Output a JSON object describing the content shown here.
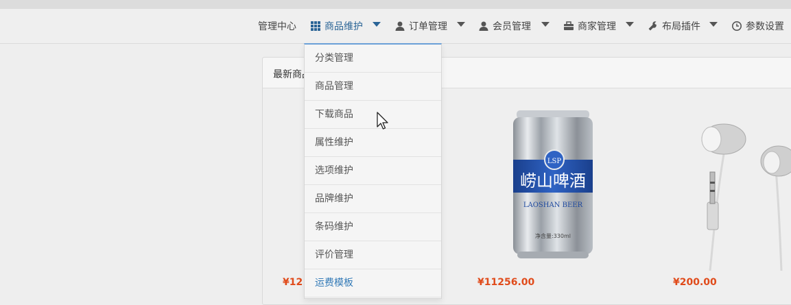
{
  "nav": {
    "items": [
      {
        "label": "管理中心"
      },
      {
        "label": "商品维护"
      },
      {
        "label": "订单管理"
      },
      {
        "label": "会员管理"
      },
      {
        "label": "商家管理"
      },
      {
        "label": "布局插件"
      },
      {
        "label": "参数设置"
      }
    ],
    "icons": [
      "grid-icon",
      "user-icon",
      "user-icon",
      "briefcase-icon",
      "wrench-icon",
      "clock-icon"
    ],
    "active_color": "#2a6496"
  },
  "dropdown": {
    "items": [
      {
        "label": "分类管理"
      },
      {
        "label": "商品管理"
      },
      {
        "label": "下载商品"
      },
      {
        "label": "属性维护"
      },
      {
        "label": "选项维护"
      },
      {
        "label": "品牌维护"
      },
      {
        "label": "条码维护"
      },
      {
        "label": "评价管理"
      },
      {
        "label": "运费模板"
      }
    ]
  },
  "panel": {
    "title": "最新商品"
  },
  "products": [
    {
      "price": "¥12",
      "image": "hidden-product"
    },
    {
      "price": "¥11256.00",
      "image": "beer-can",
      "can_brand": "崂山啤酒",
      "can_brand_en": "LAOSHAN BEER",
      "can_volume": "净含量:330ml",
      "can_logo": "LSP"
    },
    {
      "price": "¥200.00",
      "image": "earphones"
    }
  ],
  "colors": {
    "price": "#e04b1b",
    "link": "#337ab7",
    "dropdown_top_border": "#6aa0d8"
  }
}
